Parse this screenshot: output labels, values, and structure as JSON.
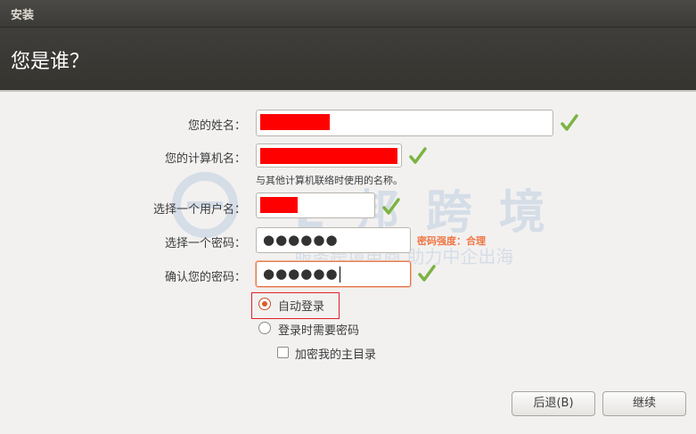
{
  "window": {
    "title": "安装"
  },
  "header": {
    "title": "您是谁？"
  },
  "form": {
    "name": {
      "label": "您的姓名："
    },
    "computer": {
      "label": "您的计算机名：",
      "hint": "与其他计算机联络时使用的名称。"
    },
    "username": {
      "label": "选择一个用户名："
    },
    "password": {
      "label": "选择一个密码：",
      "value": "●●●●●●",
      "strength": "密码强度：合理"
    },
    "confirm": {
      "label": "确认您的密码：",
      "value": "●●●●●●"
    }
  },
  "options": {
    "auto_login": {
      "label": "自动登录",
      "selected": true
    },
    "require_password": {
      "label": "登录时需要密码",
      "selected": false
    },
    "encrypt_home": {
      "label": "加密我的主目录",
      "checked": false
    }
  },
  "buttons": {
    "back": "后退(B)",
    "continue": "继续"
  },
  "watermark": {
    "brand": "E 邦 跨 境",
    "slogan": "服务跨境电商  助力中企出海"
  },
  "colors": {
    "redaction": "#ff0000",
    "check": "#7cb342",
    "strength": "#f07746",
    "highlight": "#e0202a"
  }
}
